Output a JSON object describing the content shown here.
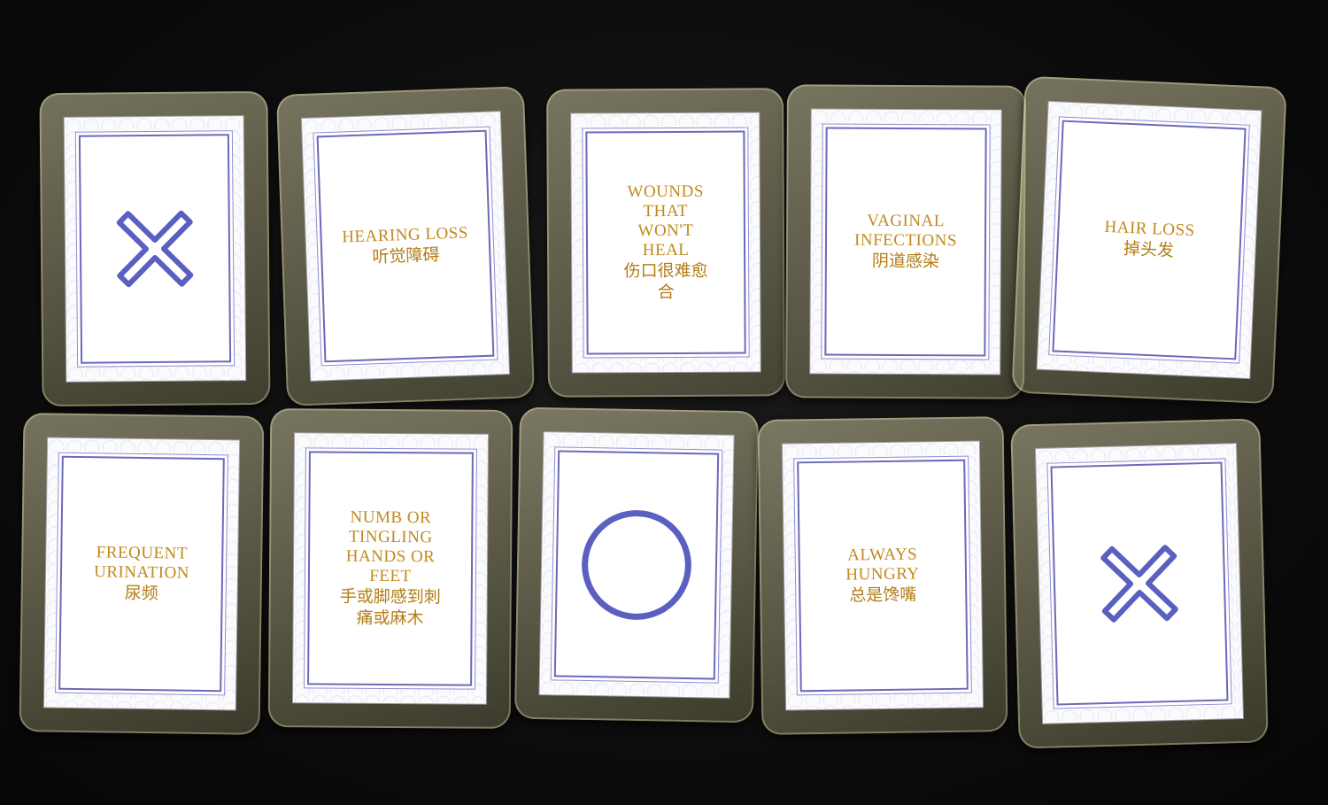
{
  "cards": [
    {
      "type": "symbol",
      "symbol_name": "x-mark-icon"
    },
    {
      "type": "text",
      "en": "HEARING LOSS",
      "zh": "听觉障碍"
    },
    {
      "type": "text",
      "en": "WOUNDS THAT WON'T HEAL",
      "zh": "伤口很难愈合"
    },
    {
      "type": "text",
      "en": "VAGINAL INFECTIONS",
      "zh": "阴道感染"
    },
    {
      "type": "text",
      "en": "HAIR LOSS",
      "zh": "掉头发"
    },
    {
      "type": "text",
      "en": "FREQUENT URINATION",
      "zh": "尿频"
    },
    {
      "type": "text",
      "en": "NUMB OR TINGLING HANDS OR FEET",
      "zh": "手或脚感到刺痛或麻木"
    },
    {
      "type": "symbol",
      "symbol_name": "circle-mark-icon"
    },
    {
      "type": "text",
      "en": "ALWAYS HUNGRY",
      "zh": "总是馋嘴"
    },
    {
      "type": "symbol",
      "symbol_name": "x-mark-icon"
    }
  ],
  "colors": {
    "text_gold": "#c08a1e",
    "symbol_blue": "#5b5fc0",
    "frame_blue": "#6b6ab8",
    "table_black": "#0e0e0e"
  }
}
